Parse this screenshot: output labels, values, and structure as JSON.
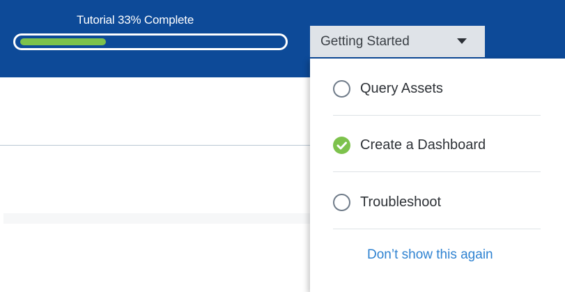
{
  "tutorial_progress": {
    "label": "Tutorial 33% Complete",
    "percent": 33
  },
  "section_dropdown": {
    "selected": "Getting Started",
    "caret_icon": "caret-down-icon"
  },
  "menu": {
    "items": [
      {
        "label": "Query Assets",
        "completed": false,
        "icon": "radio-empty-icon"
      },
      {
        "label": "Create a Dashboard",
        "completed": true,
        "icon": "check-circle-icon"
      },
      {
        "label": "Troubleshoot",
        "completed": false,
        "icon": "radio-empty-icon"
      }
    ],
    "dismiss_label": "Don’t show this again"
  },
  "colors": {
    "header_background": "#0d4a98",
    "progress_fill": "#7dc24c",
    "link": "#2e82d1",
    "check": "#7dc24c"
  }
}
